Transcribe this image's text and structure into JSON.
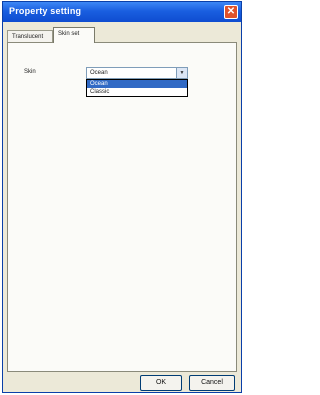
{
  "window": {
    "title": "Property setting"
  },
  "tabs": [
    {
      "label": "Translucent"
    },
    {
      "label": "Skin set"
    }
  ],
  "skin": {
    "label": "Skin",
    "selected": "Ocean",
    "options": [
      "Ocean",
      "Classic"
    ]
  },
  "buttons": {
    "ok": "OK",
    "cancel": "Cancel"
  }
}
